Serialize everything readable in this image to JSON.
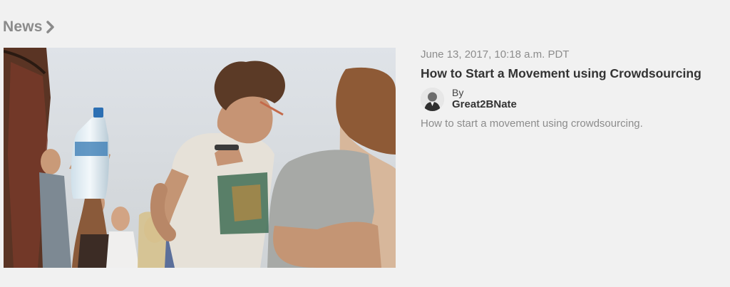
{
  "section": {
    "title": "News",
    "chevron_icon": "chevron-right-icon"
  },
  "article": {
    "image_alt": "Group of young people at an outdoor festival",
    "timestamp": "June 13, 2017, 10:18 a.m. PDT",
    "headline": "How to Start a Movement using Crowdsourcing",
    "by_label": "By",
    "author": "Great2BNate",
    "summary": "How to start a movement using crowdsourcing."
  },
  "colors": {
    "background": "#f1f1f1",
    "section_title": "#8a8a8a",
    "headline": "#333333",
    "muted_text": "#8c8c8c"
  }
}
